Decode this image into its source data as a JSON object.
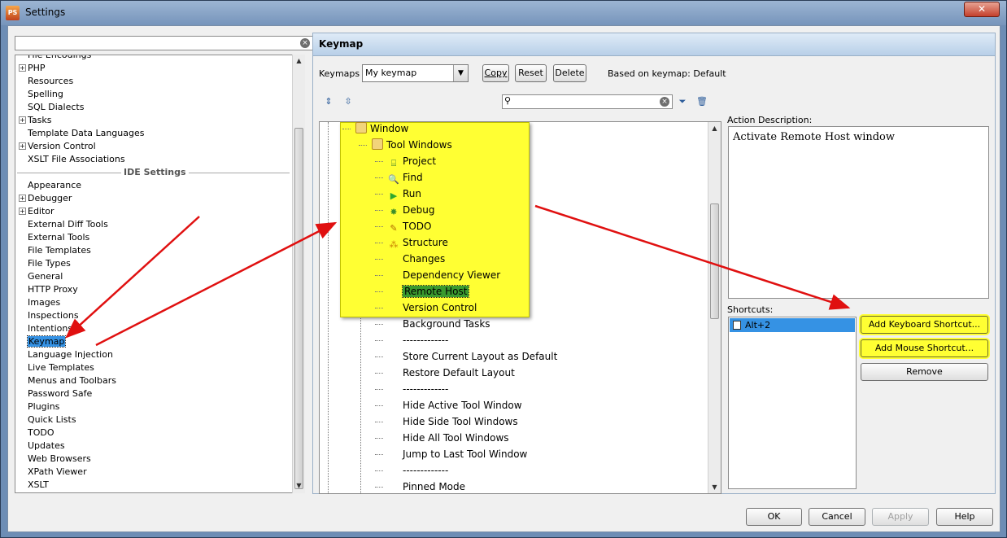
{
  "window": {
    "title": "Settings",
    "close_label": "✕"
  },
  "left": {
    "search": {
      "value": ""
    },
    "items_top": [
      {
        "label": "File Encodings",
        "expander": false
      },
      {
        "label": "PHP",
        "expander": true
      },
      {
        "label": "Resources",
        "expander": false
      },
      {
        "label": "Spelling",
        "expander": false
      },
      {
        "label": "SQL Dialects",
        "expander": false
      },
      {
        "label": "Tasks",
        "expander": true
      },
      {
        "label": "Template Data Languages",
        "expander": false
      },
      {
        "label": "Version Control",
        "expander": true
      },
      {
        "label": "XSLT File Associations",
        "expander": false
      }
    ],
    "section_label": "IDE Settings",
    "items_ide": [
      {
        "label": "Appearance",
        "expander": false
      },
      {
        "label": "Debugger",
        "expander": true
      },
      {
        "label": "Editor",
        "expander": true
      },
      {
        "label": "External Diff Tools",
        "expander": false
      },
      {
        "label": "External Tools",
        "expander": false
      },
      {
        "label": "File Templates",
        "expander": false
      },
      {
        "label": "File Types",
        "expander": false
      },
      {
        "label": "General",
        "expander": false
      },
      {
        "label": "HTTP Proxy",
        "expander": false
      },
      {
        "label": "Images",
        "expander": false
      },
      {
        "label": "Inspections",
        "expander": false
      },
      {
        "label": "Intentions",
        "expander": false
      },
      {
        "label": "Keymap",
        "expander": false,
        "selected": true
      },
      {
        "label": "Language Injection",
        "expander": false
      },
      {
        "label": "Live Templates",
        "expander": false
      },
      {
        "label": "Menus and Toolbars",
        "expander": false
      },
      {
        "label": "Password Safe",
        "expander": false
      },
      {
        "label": "Plugins",
        "expander": false
      },
      {
        "label": "Quick Lists",
        "expander": false
      },
      {
        "label": "TODO",
        "expander": false
      },
      {
        "label": "Updates",
        "expander": false
      },
      {
        "label": "Web Browsers",
        "expander": false
      },
      {
        "label": "XPath Viewer",
        "expander": false
      },
      {
        "label": "XSLT",
        "expander": false
      }
    ]
  },
  "keymap": {
    "header": "Keymap",
    "keymaps_label": "Keymaps",
    "selected_keymap": "My keymap",
    "copy_label": "Copy",
    "reset_label": "Reset",
    "delete_label": "Delete",
    "based_on": "Based on keymap: Default",
    "search_value": ""
  },
  "tree": {
    "window": "Window",
    "tool_windows": "Tool Windows",
    "tool_items": [
      {
        "label": "Project",
        "icon": "project-icon",
        "glyph": "⌸",
        "color": "#3a7d2e"
      },
      {
        "label": "Find",
        "icon": "find-icon",
        "glyph": "🔍",
        "color": "#6a8d2e"
      },
      {
        "label": "Run",
        "icon": "run-icon",
        "glyph": "▶",
        "color": "#2fa82f"
      },
      {
        "label": "Debug",
        "icon": "debug-icon",
        "glyph": "✸",
        "color": "#3f8f2a"
      },
      {
        "label": "TODO",
        "icon": "todo-icon",
        "glyph": "✎",
        "color": "#b06a00"
      },
      {
        "label": "Structure",
        "icon": "structure-icon",
        "glyph": "⁂",
        "color": "#c87f00"
      },
      {
        "label": "Changes",
        "icon": "",
        "glyph": "",
        "color": ""
      },
      {
        "label": "Dependency Viewer",
        "icon": "",
        "glyph": "",
        "color": ""
      },
      {
        "label": "Remote Host",
        "icon": "",
        "glyph": "",
        "color": "",
        "selected": true
      },
      {
        "label": "Version Control",
        "icon": "",
        "glyph": "",
        "color": ""
      }
    ],
    "window_items": [
      "Background Tasks",
      "-------------",
      "Store Current Layout as Default",
      "Restore Default Layout",
      "-------------",
      "Hide Active Tool Window",
      "Hide Side Tool Windows",
      "Hide All Tool Windows",
      "Jump to Last Tool Window",
      "-------------",
      "Pinned Mode"
    ]
  },
  "action_description": {
    "label": "Action Description:",
    "text": "Activate Remote Host window"
  },
  "shortcuts": {
    "label": "Shortcuts:",
    "items": [
      "Alt+2"
    ],
    "add_keyboard": "Add Keyboard Shortcut...",
    "add_mouse": "Add Mouse Shortcut...",
    "remove": "Remove"
  },
  "footer": {
    "ok": "OK",
    "cancel": "Cancel",
    "apply": "Apply",
    "help": "Help"
  },
  "colors": {
    "highlight": "#ffff33",
    "selection": "#3592e4",
    "arrow": "#e01010"
  }
}
